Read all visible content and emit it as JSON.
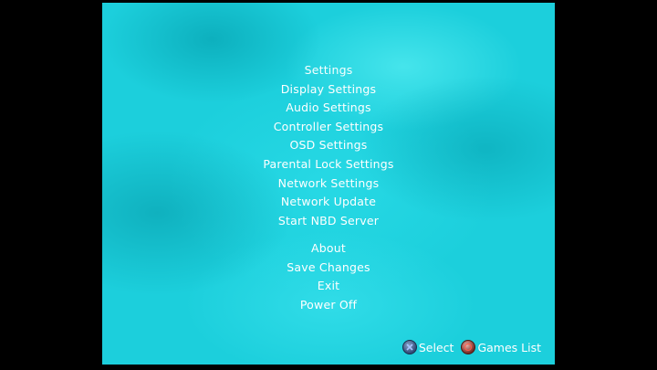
{
  "menu": {
    "title": "Settings",
    "items": [
      {
        "label": "Display Settings"
      },
      {
        "label": "Audio Settings"
      },
      {
        "label": "Controller Settings"
      },
      {
        "label": "OSD Settings"
      },
      {
        "label": "Parental Lock Settings"
      },
      {
        "label": "Network Settings"
      },
      {
        "label": "Network Update"
      },
      {
        "label": "Start NBD Server"
      }
    ],
    "secondary_items": [
      {
        "label": "About"
      },
      {
        "label": "Save Changes"
      },
      {
        "label": "Exit"
      },
      {
        "label": "Power Off"
      }
    ]
  },
  "footer": {
    "select_icon": "cross-button-icon",
    "select_label": "Select",
    "back_icon": "circle-button-icon",
    "back_label": "Games List"
  },
  "colors": {
    "background": "#1ccfdc",
    "text": "#ffffff",
    "letterbox": "#000000"
  }
}
